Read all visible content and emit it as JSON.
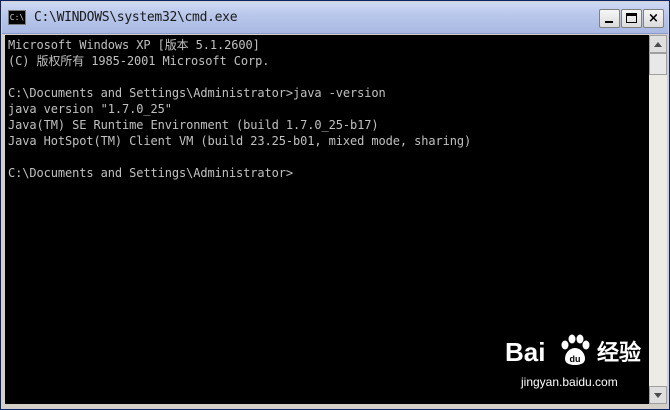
{
  "window": {
    "title": "C:\\WINDOWS\\system32\\cmd.exe",
    "icon_text": "C:\\"
  },
  "controls": {
    "close_glyph": "×"
  },
  "console": {
    "lines": [
      "Microsoft Windows XP [版本 5.1.2600]",
      "(C) 版权所有 1985-2001 Microsoft Corp.",
      "",
      "C:\\Documents and Settings\\Administrator>java -version",
      "java version \"1.7.0_25\"",
      "Java(TM) SE Runtime Environment (build 1.7.0_25-b17)",
      "Java HotSpot(TM) Client VM (build 23.25-b01, mixed mode, sharing)",
      "",
      "C:\\Documents and Settings\\Administrator>"
    ]
  },
  "watermark": {
    "brand": "Bai",
    "product": "经验",
    "url": "jingyan.baidu.com"
  },
  "colors": {
    "console_bg": "#000000",
    "console_fg": "#c0c0c0",
    "titlebar": "#b7c6ea"
  }
}
